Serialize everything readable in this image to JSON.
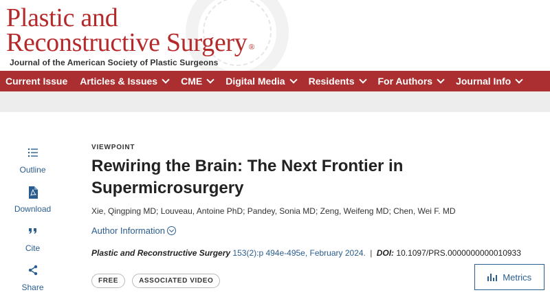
{
  "header": {
    "journal_line1": "Plastic and",
    "journal_line2": "Reconstructive Surgery",
    "registered_mark": "®",
    "subtitle": "Journal of the American Society of Plastic Surgeons"
  },
  "nav": {
    "items": [
      {
        "label": "Current Issue",
        "has_dropdown": false
      },
      {
        "label": "Articles & Issues",
        "has_dropdown": true
      },
      {
        "label": "CME",
        "has_dropdown": true
      },
      {
        "label": "Digital Media",
        "has_dropdown": true
      },
      {
        "label": "Residents",
        "has_dropdown": true
      },
      {
        "label": "For Authors",
        "has_dropdown": true
      },
      {
        "label": "Journal Info",
        "has_dropdown": true
      }
    ]
  },
  "sidebar": {
    "items": [
      {
        "label": "Outline",
        "icon": "list-icon"
      },
      {
        "label": "Download",
        "icon": "pdf-icon"
      },
      {
        "label": "Cite",
        "icon": "quote-icon"
      },
      {
        "label": "Share",
        "icon": "share-icon"
      }
    ]
  },
  "article": {
    "kicker": "VIEWPOINT",
    "title": "Rewiring the Brain: The Next Frontier in Supermicrosurgery",
    "authors": "Xie, Qingping MD; Louveau, Antoine PhD; Pandey, Sonia MD; Zeng, Weifeng MD; Chen, Wei F. MD",
    "author_info_label": "Author Information",
    "citation": {
      "journal": "Plastic and Reconstructive Surgery",
      "volume_pages": "153(2):p 494e-495e, February 2024.",
      "separator": "|",
      "doi_label": "DOI:",
      "doi": "10.1097/PRS.0000000000010933"
    },
    "tags": [
      "FREE",
      "ASSOCIATED VIDEO"
    ],
    "metrics_label": "Metrics"
  },
  "colors": {
    "brand_red": "#ab2e30",
    "link_blue": "#2a5d8f",
    "band_grey": "#ededed"
  }
}
